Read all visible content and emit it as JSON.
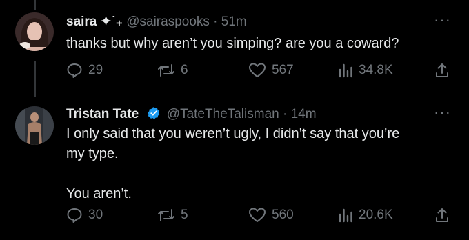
{
  "tweets": [
    {
      "name": "saira",
      "name_decoration": "✦˙₊",
      "handle": "@sairaspooks",
      "separator": "·",
      "time": "51m",
      "text": "thanks but why aren’t you simping? are you a coward?",
      "replies": "29",
      "retweets": "6",
      "likes": "567",
      "views": "34.8K",
      "verified": false
    },
    {
      "name": "Tristan Tate",
      "handle": "@TateTheTalisman",
      "separator": "·",
      "time": "14m",
      "text": "I only said that you weren’t ugly, I didn’t say that you’re\nmy type.\n\nYou aren’t.",
      "replies": "30",
      "retweets": "5",
      "likes": "560",
      "views": "20.6K",
      "verified": true
    }
  ],
  "colors": {
    "background": "#000000",
    "text": "#e7e9ea",
    "muted": "#71767b",
    "verified": "#1d9bf0"
  },
  "more_icon": "···"
}
